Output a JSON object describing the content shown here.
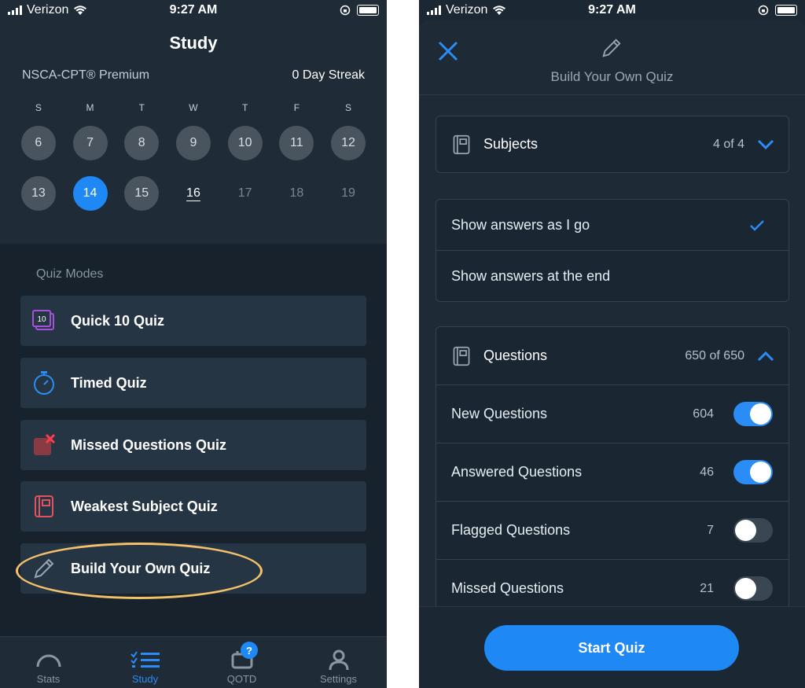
{
  "status_bar": {
    "carrier": "Verizon",
    "time": "9:27 AM"
  },
  "left": {
    "title": "Study",
    "program": "NSCA-CPT® Premium",
    "streak": "0 Day Streak",
    "days_of_week": [
      "S",
      "M",
      "T",
      "W",
      "T",
      "F",
      "S"
    ],
    "week1": [
      "6",
      "7",
      "8",
      "9",
      "10",
      "11",
      "12"
    ],
    "week2": [
      "13",
      "14",
      "15",
      "16",
      "17",
      "18",
      "19"
    ],
    "selected_day": "14",
    "today": "16",
    "quiz_modes_label": "Quiz Modes",
    "modes": [
      {
        "label": "Quick 10 Quiz",
        "icon": "quick10-icon",
        "icon_text": "10"
      },
      {
        "label": "Timed Quiz",
        "icon": "stopwatch-icon"
      },
      {
        "label": "Missed Questions Quiz",
        "icon": "missed-x-icon"
      },
      {
        "label": "Weakest Subject Quiz",
        "icon": "book-icon"
      },
      {
        "label": "Build Your Own Quiz",
        "icon": "pencil-icon"
      }
    ],
    "tabs": [
      {
        "label": "Stats",
        "icon": "gauge-icon"
      },
      {
        "label": "Study",
        "icon": "checklist-icon",
        "active": true
      },
      {
        "label": "QOTD",
        "icon": "calendar-icon",
        "badge": "?"
      },
      {
        "label": "Settings",
        "icon": "person-icon"
      }
    ],
    "colors": {
      "accent": "#1e88f5",
      "highlight": "#f3c06b"
    }
  },
  "right": {
    "title": "Build Your Own Quiz",
    "subjects": {
      "label": "Subjects",
      "count": "4 of 4"
    },
    "answer_options": [
      {
        "label": "Show answers as I go",
        "checked": true
      },
      {
        "label": "Show answers at the end",
        "checked": false
      }
    ],
    "questions": {
      "label": "Questions",
      "count": "650 of 650"
    },
    "question_filters": [
      {
        "label": "New Questions",
        "count": "604",
        "on": true
      },
      {
        "label": "Answered Questions",
        "count": "46",
        "on": true
      },
      {
        "label": "Flagged Questions",
        "count": "7",
        "on": false
      },
      {
        "label": "Missed Questions",
        "count": "21",
        "on": false
      }
    ],
    "start_button": "Start Quiz"
  }
}
